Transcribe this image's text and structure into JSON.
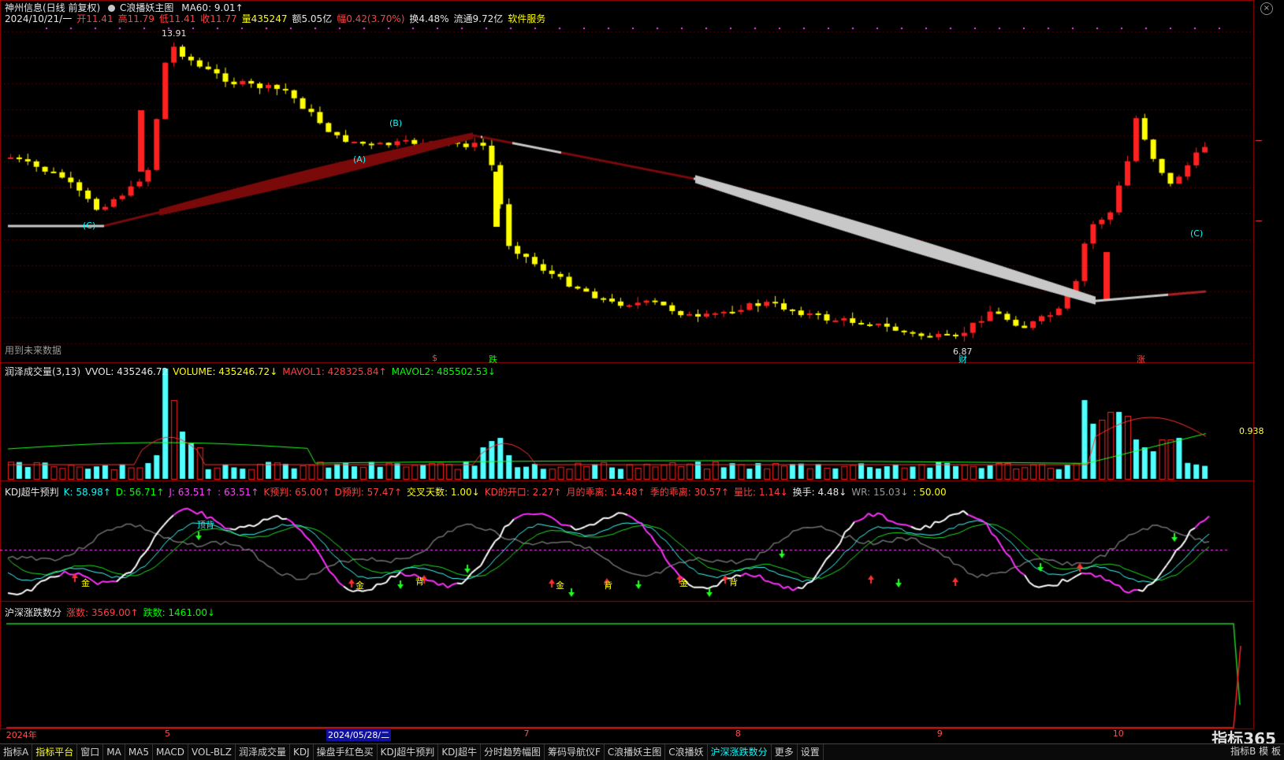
{
  "main_header": {
    "stock": "神州信息(日线 前复权)",
    "indicator": "C浪播妖主图",
    "ma60": "MA60: 9.01↑",
    "line2": [
      {
        "t": "2024/10/21/一",
        "c": "white"
      },
      {
        "t": "开11.41",
        "c": "red"
      },
      {
        "t": "高11.79",
        "c": "red"
      },
      {
        "t": "低11.41",
        "c": "red"
      },
      {
        "t": "收11.77",
        "c": "red"
      },
      {
        "t": "量435247",
        "c": "yel"
      },
      {
        "t": "额5.05亿",
        "c": "white"
      },
      {
        "t": "幅0.42(3.70%)",
        "c": "red"
      },
      {
        "t": "换4.48%",
        "c": "white"
      },
      {
        "t": "流通9.72亿",
        "c": "white"
      },
      {
        "t": "软件服务",
        "c": "yel"
      }
    ],
    "future_note": "用到未来数据"
  },
  "vol_header": [
    {
      "t": "润泽成交量(3,13)",
      "c": "white"
    },
    {
      "t": "VVOL: 435246.72",
      "c": "white"
    },
    {
      "t": "VOLUME: 435246.72↓",
      "c": "yel"
    },
    {
      "t": "MAVOL1: 428325.84↑",
      "c": "red"
    },
    {
      "t": "MAVOL2: 485502.53↓",
      "c": "grn"
    }
  ],
  "kdj_header": [
    {
      "t": "KDJ超牛预判",
      "c": "white"
    },
    {
      "t": "K: 58.98↑",
      "c": "cyan"
    },
    {
      "t": "D: 56.71↑",
      "c": "grn"
    },
    {
      "t": "J: 63.51↑",
      "c": "mag"
    },
    {
      "t": ": 63.51↑",
      "c": "mag"
    },
    {
      "t": "K预判: 65.00↑",
      "c": "red"
    },
    {
      "t": "D预判: 57.47↑",
      "c": "red"
    },
    {
      "t": "交叉天数: 1.00↓",
      "c": "yel"
    },
    {
      "t": "KD的开口: 2.27↑",
      "c": "red"
    },
    {
      "t": "月的乖离: 14.48↑",
      "c": "red"
    },
    {
      "t": "季的乖离: 30.57↑",
      "c": "red"
    },
    {
      "t": "量比: 1.14↓",
      "c": "red"
    },
    {
      "t": "换手: 4.48↓",
      "c": "white"
    },
    {
      "t": "WR: 15.03↓",
      "c": "gray"
    },
    {
      "t": ": 50.00",
      "c": "yel"
    }
  ],
  "adv_header": [
    {
      "t": "沪深涨跌数分",
      "c": "white"
    },
    {
      "t": "涨数: 3569.00↑",
      "c": "red"
    },
    {
      "t": "跌数: 1461.00↓",
      "c": "grn"
    }
  ],
  "chart_labels": {
    "high": "13.91",
    "low": "6.87",
    "ratio": "0.938",
    "wave_a": "(A)",
    "wave_b": "(B)",
    "wave_c1": "(C)",
    "wave_c2": "(C)",
    "jin1": "金",
    "jin2": "金",
    "jin3": "金",
    "jin4": "金",
    "bei1": "顶背",
    "bei2": "背",
    "bei3": "背",
    "bei4": "背",
    "s_mark": "$",
    "die": "跌",
    "cai": "财",
    "zhang": "涨"
  },
  "dates": [
    {
      "t": "2024年",
      "pos": 0.005
    },
    {
      "t": "5",
      "pos": 0.134
    },
    {
      "t": "7",
      "pos": 0.426
    },
    {
      "t": "8",
      "pos": 0.598
    },
    {
      "t": "9",
      "pos": 0.762
    },
    {
      "t": "10",
      "pos": 0.905
    }
  ],
  "selected_date": "2024/05/28/二",
  "tabs": [
    "指标A",
    "指标平台",
    "窗口",
    "MA",
    "MA5",
    "MACD",
    "VOL-BLZ",
    "润泽成交量",
    "KDJ",
    "操盘手红色买",
    "KDJ超牛预判",
    "KDJ超牛",
    "分时趋势幅图",
    "筹码导航仪F",
    "C浪播妖主图",
    "C浪播妖",
    "沪深涨跌数分",
    "更多",
    "设置"
  ],
  "tabs_right": "指标B  模  板",
  "brand": "指标365"
}
